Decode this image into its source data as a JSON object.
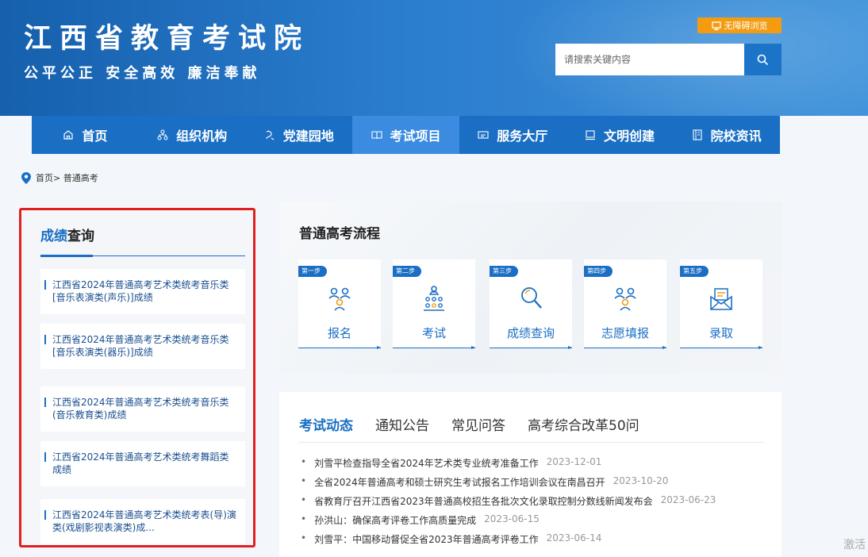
{
  "header": {
    "title": "江西省教育考试院",
    "slogan": "公平公正  安全高效  廉洁奉献",
    "accessibility_label": "无障碍浏览",
    "search_placeholder": "请搜索关键内容"
  },
  "nav": {
    "items": [
      {
        "label": "首页",
        "icon": "home-icon"
      },
      {
        "label": "组织机构",
        "icon": "org-icon"
      },
      {
        "label": "党建园地",
        "icon": "party-icon"
      },
      {
        "label": "考试项目",
        "icon": "book-icon"
      },
      {
        "label": "服务大厅",
        "icon": "service-icon"
      },
      {
        "label": "文明创建",
        "icon": "monitor-icon"
      },
      {
        "label": "院校资讯",
        "icon": "document-icon"
      }
    ],
    "active_index": 3
  },
  "breadcrumb": {
    "text": "首页> 普通高考"
  },
  "sidebar": {
    "title_highlight": "成绩",
    "title_rest": "查询",
    "items": [
      "江西省2024年普通高考艺术类统考音乐类[音乐表演类(声乐)]成绩",
      "江西省2024年普通高考艺术类统考音乐类[音乐表演类(器乐)]成绩",
      "江西省2024年普通高考艺术类统考音乐类(音乐教育类)成绩",
      "江西省2024年普通高考艺术类统考舞蹈类成绩",
      "江西省2024年普通高考艺术类统考表(导)演类(戏剧影视表演类)成..."
    ]
  },
  "flow": {
    "title": "普通高考流程",
    "steps": [
      {
        "badge": "第一步",
        "label": "报名",
        "icon": "people-icon"
      },
      {
        "badge": "第二步",
        "label": "考试",
        "icon": "exam-icon"
      },
      {
        "badge": "第三步",
        "label": "成绩查询",
        "icon": "magnifier-icon"
      },
      {
        "badge": "第四步",
        "label": "志愿填报",
        "icon": "people-icon"
      },
      {
        "badge": "第五步",
        "label": "录取",
        "icon": "envelope-icon"
      }
    ]
  },
  "news": {
    "tabs": [
      "考试动态",
      "通知公告",
      "常见问答",
      "高考综合改革50问"
    ],
    "active_tab": 0,
    "items": [
      {
        "title": "刘雪平检查指导全省2024年艺术类专业统考准备工作",
        "date": "2023-12-01"
      },
      {
        "title": "全省2024年普通高考和硕士研究生考试报名工作培训会议在南昌召开",
        "date": "2023-10-20"
      },
      {
        "title": "省教育厅召开江西省2023年普通高校招生各批次文化录取控制分数线新闻发布会",
        "date": "2023-06-23"
      },
      {
        "title": "孙洪山：确保高考评卷工作高质量完成",
        "date": "2023-06-15"
      },
      {
        "title": "刘雪平：中国移动督促全省2023年普通高考评卷工作",
        "date": "2023-06-14"
      }
    ]
  },
  "watermark": "激活"
}
